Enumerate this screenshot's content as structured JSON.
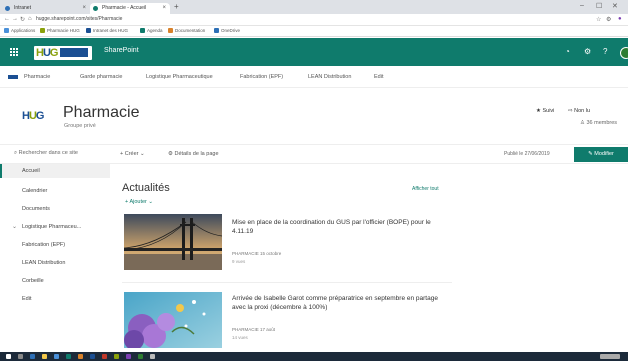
{
  "browser": {
    "tabs": [
      {
        "label": "Intranet"
      },
      {
        "label": "Pharmacie - Accueil"
      }
    ],
    "new_tab": "+",
    "window_controls": [
      "–",
      "☐",
      "✕"
    ],
    "url": "hugge.sharepoint.com/sites/Pharmacie",
    "bookmarks": [
      {
        "label": "Applications",
        "color": "#4a90d9"
      },
      {
        "label": "Pharmacie HUG",
        "color": "#8aa10c"
      },
      {
        "label": "Intranet des HUG",
        "color": "#1b4f93"
      },
      {
        "label": "Agenda",
        "color": "#0f7b6c"
      },
      {
        "label": "Documentation",
        "color": "#d9822b"
      },
      {
        "label": "OneDrive",
        "color": "#2d6fb6"
      }
    ]
  },
  "suite": {
    "app_name": "SharePoint",
    "icons": [
      "bell-icon",
      "gear-icon",
      "help-icon"
    ],
    "brand_color": "#0f7b6c"
  },
  "hub_nav": {
    "items": [
      "Pharmacie",
      "Garde pharmacie",
      "Logistique Pharmaceutique",
      "Fabrication (EPF)",
      "LEAN Distribution",
      "Edit"
    ]
  },
  "site": {
    "title": "Pharmacie",
    "subtitle": "Groupe privé",
    "follow_label": "Suivi",
    "share_label": "Non lu",
    "members_label": "36 membres"
  },
  "command_bar": {
    "search_placeholder": "Rechercher dans ce site",
    "new_label": "Créer",
    "page_details_label": "Détails de la page",
    "published_label": "Publié le 27/06/2019",
    "edit_label": "Modifier"
  },
  "left_nav": {
    "items": [
      {
        "label": "Accueil",
        "active": true
      },
      {
        "label": "Calendrier",
        "active": false
      },
      {
        "label": "Documents",
        "active": false
      },
      {
        "label": "Logistique Pharmaceu...",
        "active": false,
        "expandable": true
      },
      {
        "label": "Fabrication (EPF)",
        "active": false
      },
      {
        "label": "LEAN Distribution",
        "active": false
      },
      {
        "label": "Corbeille",
        "active": false
      },
      {
        "label": "Edit",
        "active": false
      }
    ]
  },
  "news": {
    "title": "Actualités",
    "view_all": "Afficher tout",
    "add_label": "Ajouter",
    "items": [
      {
        "headline": "Mise en place de la coordination du GUS par l'officier (BOPE) pour le 4.11.19",
        "author": "PHARMACIE",
        "date": "15 octobre",
        "views": "9 vues",
        "thumb": "bridge"
      },
      {
        "headline": "Arrivée de Isabelle Garot comme préparatrice en septembre en partage avec la proxi (décembre à 100%)",
        "author": "PHARMACIE",
        "date": "17 août",
        "views": "14 vues",
        "thumb": "flowers"
      }
    ]
  }
}
